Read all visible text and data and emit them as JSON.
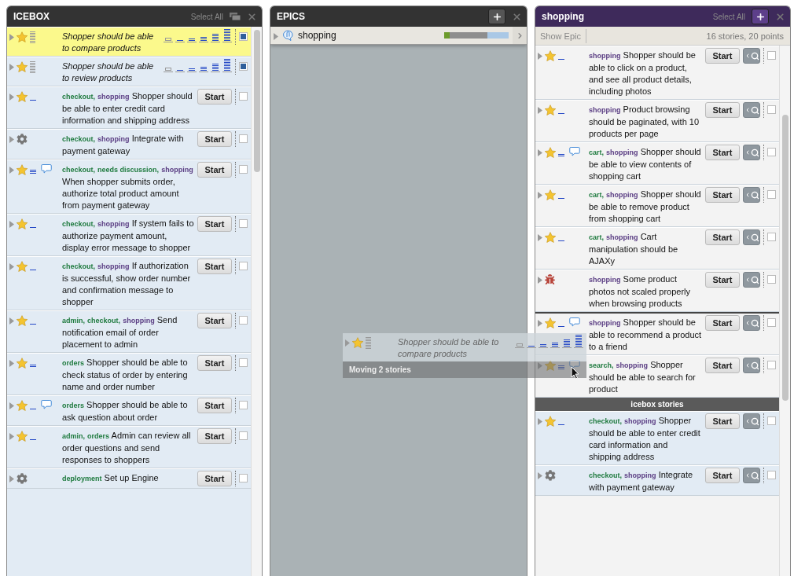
{
  "icebox": {
    "title": "ICEBOX",
    "select_all": "Select All",
    "stories": [
      {
        "kind": "feature",
        "estimate": {
          "kind": "unestimated"
        },
        "comments": false,
        "highlighted": true,
        "selected": true,
        "text": "Shopper should be able to compare products"
      },
      {
        "kind": "feature",
        "estimate": {
          "kind": "unestimated"
        },
        "comments": false,
        "highlighted": false,
        "selected": true,
        "text": "Shopper should be able to review products"
      },
      {
        "kind": "feature",
        "estimate": {
          "kind": "one"
        },
        "comments": false,
        "highlighted": false,
        "selected": false,
        "labels": [
          {
            "text": "checkout,",
            "epic": false
          },
          {
            "text": "shopping",
            "epic": true
          }
        ],
        "text": "Shopper should be able to enter credit card information and shipping address",
        "action": "Start"
      },
      {
        "kind": "chore",
        "comments": false,
        "highlighted": false,
        "selected": false,
        "labels": [
          {
            "text": "checkout,",
            "epic": false
          },
          {
            "text": "shopping",
            "epic": true
          }
        ],
        "text": "Integrate with payment gateway",
        "action": "Start"
      },
      {
        "kind": "feature",
        "estimate": {
          "kind": "three"
        },
        "comments": true,
        "highlighted": false,
        "selected": false,
        "labels": [
          {
            "text": "checkout,",
            "epic": false
          },
          {
            "text": "needs discussion,",
            "epic": false
          },
          {
            "text": "shopping",
            "epic": true
          }
        ],
        "text": "When shopper submits order, authorize total product amount from payment gateway",
        "action": "Start"
      },
      {
        "kind": "feature",
        "estimate": {
          "kind": "one"
        },
        "comments": false,
        "highlighted": false,
        "selected": false,
        "labels": [
          {
            "text": "checkout,",
            "epic": false
          },
          {
            "text": "shopping",
            "epic": true
          }
        ],
        "text": "If system fails to authorize payment amount, display error message to shopper",
        "action": "Start"
      },
      {
        "kind": "feature",
        "estimate": {
          "kind": "one"
        },
        "comments": false,
        "highlighted": false,
        "selected": false,
        "labels": [
          {
            "text": "checkout,",
            "epic": false
          },
          {
            "text": "shopping",
            "epic": true
          }
        ],
        "text": "If authorization is successful, show order number and confirmation message to shopper",
        "action": "Start"
      },
      {
        "kind": "feature",
        "estimate": {
          "kind": "one"
        },
        "comments": false,
        "highlighted": false,
        "selected": false,
        "labels": [
          {
            "text": "admin,",
            "epic": false
          },
          {
            "text": "checkout,",
            "epic": false
          },
          {
            "text": "shopping",
            "epic": true
          }
        ],
        "text": "Send notification email of order placement to admin",
        "action": "Start"
      },
      {
        "kind": "feature",
        "estimate": {
          "kind": "two"
        },
        "comments": false,
        "highlighted": false,
        "selected": false,
        "labels": [
          {
            "text": "orders",
            "epic": false
          }
        ],
        "text": "Shopper should be able to check status of order by entering name and order number",
        "action": "Start"
      },
      {
        "kind": "feature",
        "estimate": {
          "kind": "one"
        },
        "comments": true,
        "highlighted": false,
        "selected": false,
        "labels": [
          {
            "text": "orders",
            "epic": false
          }
        ],
        "text": "Shopper should be able to ask question about order",
        "action": "Start"
      },
      {
        "kind": "feature",
        "estimate": {
          "kind": "one"
        },
        "comments": false,
        "highlighted": false,
        "selected": false,
        "labels": [
          {
            "text": "admin,",
            "epic": false
          },
          {
            "text": "orders",
            "epic": false
          }
        ],
        "text": "Admin can review all order questions and send responses to shoppers",
        "action": "Start"
      },
      {
        "kind": "chore",
        "comments": false,
        "highlighted": false,
        "selected": false,
        "labels": [
          {
            "text": "deployment",
            "epic": false
          }
        ],
        "text": "Set up Engine",
        "action": "Start"
      }
    ]
  },
  "epics": {
    "title": "EPICS",
    "items": [
      {
        "name": "shopping",
        "progress": {
          "level": 0.67
        },
        "accepted": {
          "level": 0.08
        }
      }
    ]
  },
  "shopping": {
    "title": "shopping",
    "select_all": "Select All",
    "show_epic": "Show Epic",
    "summary": "16 stories, 20 points",
    "stories": [
      {
        "kind": "feature",
        "estimate": {
          "kind": "one"
        },
        "comments": false,
        "drop_before": false,
        "selected": false,
        "labels": [
          {
            "text": "shopping",
            "epic": true
          }
        ],
        "text": "Shopper should be able to click on a product, and see all product details, including photos",
        "action": "Start"
      },
      {
        "kind": "feature",
        "estimate": {
          "kind": "one"
        },
        "comments": false,
        "drop_before": false,
        "selected": false,
        "labels": [
          {
            "text": "shopping",
            "epic": true
          }
        ],
        "text": "Product browsing should be paginated, with 10 products per page",
        "action": "Start"
      },
      {
        "kind": "feature",
        "estimate": {
          "kind": "two"
        },
        "comments": true,
        "drop_before": false,
        "selected": false,
        "labels": [
          {
            "text": "cart,",
            "epic": false
          },
          {
            "text": "shopping",
            "epic": true
          }
        ],
        "text": "Shopper should be able to view contents of shopping cart",
        "action": "Start"
      },
      {
        "kind": "feature",
        "estimate": {
          "kind": "one"
        },
        "comments": false,
        "drop_before": false,
        "selected": false,
        "labels": [
          {
            "text": "cart,",
            "epic": false
          },
          {
            "text": "shopping",
            "epic": true
          }
        ],
        "text": "Shopper should be able to remove product from shopping cart",
        "action": "Start"
      },
      {
        "kind": "feature",
        "estimate": {
          "kind": "one"
        },
        "comments": false,
        "drop_before": false,
        "selected": false,
        "labels": [
          {
            "text": "cart,",
            "epic": false
          },
          {
            "text": "shopping",
            "epic": true
          }
        ],
        "text": "Cart manipulation should be AJAXy",
        "action": "Start"
      },
      {
        "kind": "bug",
        "comments": false,
        "drop_before": false,
        "selected": false,
        "labels": [
          {
            "text": "shopping",
            "epic": true
          }
        ],
        "text": "Some product photos not scaled properly when browsing products",
        "action": "Start"
      },
      {
        "kind": "feature",
        "estimate": {
          "kind": "one"
        },
        "comments": true,
        "drop_before": true,
        "selected": false,
        "labels": [
          {
            "text": "shopping",
            "epic": true
          }
        ],
        "text": "Shopper should be able to recommend a product to a friend",
        "action": "Start"
      },
      {
        "kind": "feature",
        "estimate": {
          "kind": "three"
        },
        "comments": true,
        "drop_before": false,
        "selected": false,
        "labels": [
          {
            "text": "search,",
            "epic": false
          },
          {
            "text": "shopping",
            "epic": true
          }
        ],
        "text": "Shopper should be able to search for product",
        "action": "Start"
      }
    ],
    "divider": "icebox stories",
    "icebox_stories": [
      {
        "kind": "feature",
        "estimate": {
          "kind": "one"
        },
        "comments": false,
        "drop_before": false,
        "selected": false,
        "labels": [
          {
            "text": "checkout,",
            "epic": false
          },
          {
            "text": "shopping",
            "epic": true
          }
        ],
        "text": "Shopper should be able to enter credit card information and shipping address",
        "action": "Start"
      },
      {
        "kind": "chore",
        "comments": false,
        "drop_before": false,
        "selected": false,
        "labels": [
          {
            "text": "checkout,",
            "epic": false
          },
          {
            "text": "shopping",
            "epic": true
          }
        ],
        "text": "Integrate with payment gateway",
        "action": "Start"
      }
    ]
  },
  "drag": {
    "story": {
      "kind": "feature",
      "estimate": {
        "kind": "unestimated"
      },
      "text": "Shopper should be able to compare products"
    },
    "caption": "Moving 2 stories"
  }
}
